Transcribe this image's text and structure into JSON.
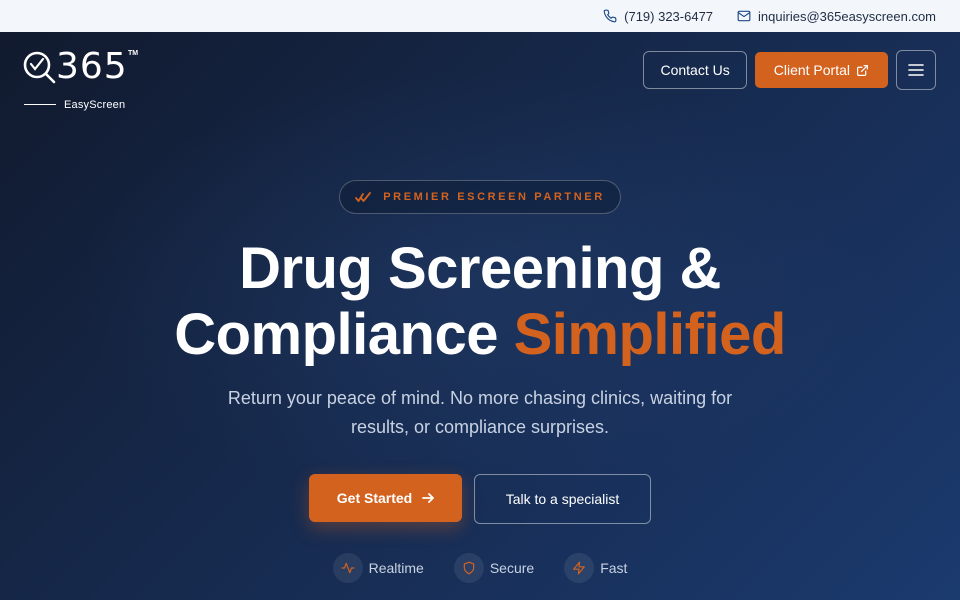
{
  "topbar": {
    "phone": "(719) 323-6477",
    "email": "inquiries@365easyscreen.com",
    "phone_icon": "phone-icon",
    "email_icon": "mail-icon"
  },
  "logo": {
    "number": "365",
    "trademark": "TM",
    "subtitle": "EasyScreen"
  },
  "nav": {
    "contact_label": "Contact Us",
    "portal_label": "Client Portal",
    "menu_icon": "hamburger-menu-icon"
  },
  "hero": {
    "badge": "PREMIER ESCREEN PARTNER",
    "headline_line1": "Drug Screening &",
    "headline_line2a": "Compliance",
    "headline_line2b": "Simplified",
    "subtitle_line1": "Return your peace of mind. No more chasing clinics, waiting for",
    "subtitle_line2": "results, or compliance surprises.",
    "primary_cta": "Get Started",
    "secondary_cta": "Talk to a specialist"
  },
  "features": [
    {
      "label": "Realtime",
      "icon": "pulse-icon"
    },
    {
      "label": "Secure",
      "icon": "shield-icon"
    },
    {
      "label": "Fast",
      "icon": "lightning-icon"
    }
  ],
  "colors": {
    "accent": "#d4621f",
    "navy": "#0f2344",
    "topbar": "#f3f6fb"
  }
}
